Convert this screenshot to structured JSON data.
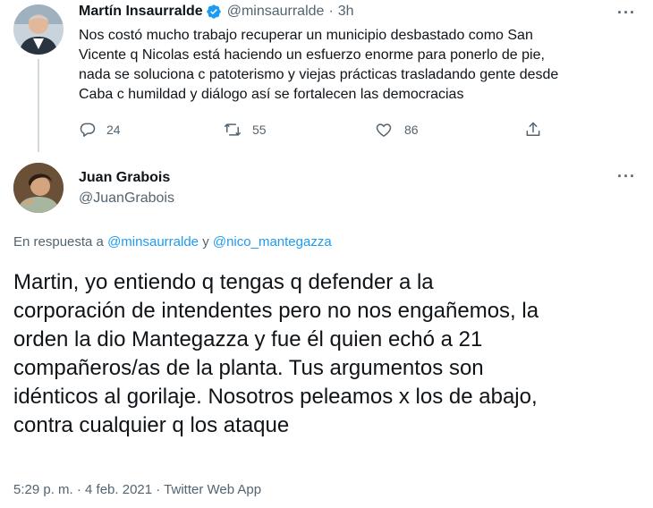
{
  "tweet1": {
    "display_name": "Martín Insaurralde",
    "handle": "@minsaurralde",
    "separator": "·",
    "time": "3h",
    "more": "···",
    "lines": [
      "Nos costó mucho trabajo recuperar un municipio desbastado como San",
      "Vicente q Nicolas está haciendo un esfuerzo enorme para ponerlo de pie,",
      "nada se soluciona c patoterismo y viejas prácticas trasladando gente desde",
      "Caba  c humildad y diálogo así se fortalecen las democracias"
    ],
    "replies": "24",
    "retweets": "55",
    "likes": "86",
    "icons": [
      "reply-icon",
      "retweet-icon",
      "like-icon",
      "share-icon",
      "verified-badge-icon"
    ]
  },
  "tweet2": {
    "display_name": "Juan Grabois",
    "handle": "@JuanGrabois",
    "more": "···",
    "reply_to_prefix": "En respuesta a",
    "reply_to_user1": "@minsaurralde",
    "reply_to_and": "y",
    "reply_to_user2": "@nico_mantegazza",
    "lines": [
      "Martin, yo entiendo q tengas q defender a la",
      "corporación de intendentes pero no nos engañemos, la",
      "orden la dio Mantegazza y fue él quien echó a 21",
      "compañeros/as de la planta. Tus argumentos son",
      "idénticos al gorilaje. Nosotros peleamos x los de abajo,",
      "contra cualquier q los ataque"
    ],
    "footer": "5:29 p. m. · 4 feb. 2021 · Twitter Web App"
  },
  "colors": {
    "accent": "#1d9bf0",
    "muted": "#536471",
    "text": "#0f1419"
  }
}
